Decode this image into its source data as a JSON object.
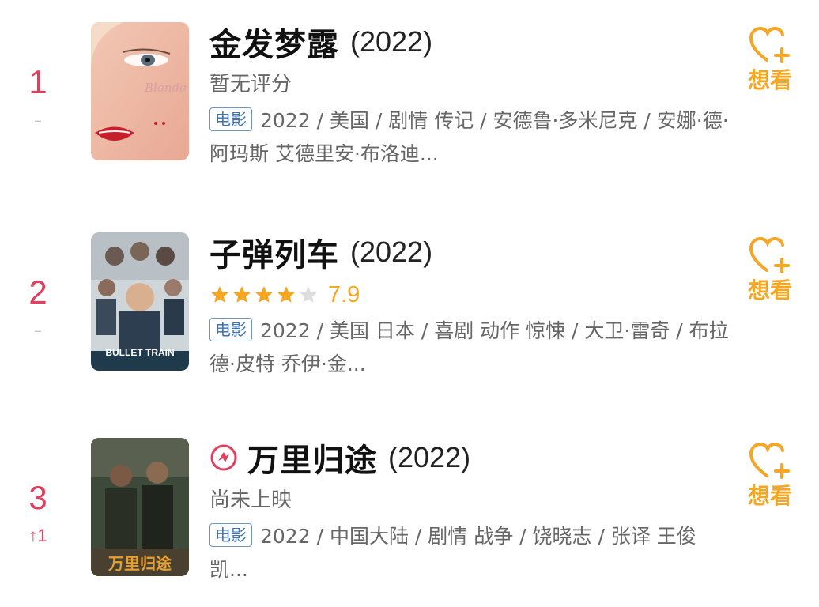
{
  "movies": [
    {
      "rank": "1",
      "trend": "–",
      "title": "金发梦露",
      "year": "(2022)",
      "status": "暂无评分",
      "tag": "电影",
      "meta": "2022 / 美国 / 剧情 传记 / 安德鲁·多米尼克 / 安娜·德·阿玛斯 艾德里安·布洛迪...",
      "want_label": "想看",
      "poster_text": "Blonde"
    },
    {
      "rank": "2",
      "trend": "–",
      "title": "子弹列车",
      "year": "(2022)",
      "rating": {
        "stars": 4,
        "max": 5,
        "score": "7.9"
      },
      "tag": "电影",
      "meta": "2022 / 美国 日本 / 喜剧 动作 惊悚 / 大卫·雷奇 / 布拉德·皮特 乔伊·金...",
      "want_label": "想看",
      "poster_text": "BULLET TRAIN"
    },
    {
      "rank": "3",
      "trend": "↑1",
      "title": "万里归途",
      "year": "(2022)",
      "status": "尚未上映",
      "tag": "电影",
      "meta": "2022 / 中国大陆 / 剧情 战争 / 饶晓志 / 张译 王俊凯...",
      "want_label": "想看",
      "poster_text": "万里归途"
    }
  ],
  "colors": {
    "rank": "#e0405e",
    "accent": "#f5a623",
    "tag": "#3f72b5"
  },
  "icons": {
    "want": "heart-plus-icon",
    "badge": "red-ribbon-icon",
    "star": "star-icon"
  }
}
